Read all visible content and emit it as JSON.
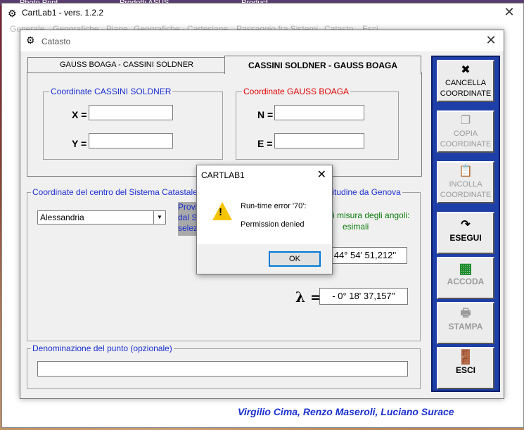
{
  "desktop": {
    "top_left_text": "Photo Print",
    "top_mid_text": "Prodotti ASUS",
    "top_right_text": "Product"
  },
  "main_window": {
    "title": "CartLab1 - vers. 1.2.2",
    "menu": [
      "Generale",
      "Geografiche - Piane",
      "Geografiche - Cartesiane",
      "Passaggio fra Sistemi",
      "Catasto",
      "Esci"
    ]
  },
  "catasto": {
    "title": "Catasto",
    "tabs": [
      "GAUSS BOAGA - CASSINI SOLDNER",
      "CASSINI SOLDNER - GAUSS BOAGA"
    ],
    "cassini_group": "Coordinate CASSINI SOLDNER",
    "gauss_group": "Coordinate GAUSS BOAGA",
    "x_label": "X =",
    "y_label": "Y =",
    "n_label": "N =",
    "e_label": "E =",
    "center_group": "Coordinate del centro del Sistema Catastale",
    "center_group_tail": "ngitudine da Genova",
    "province_select": "Alessandria",
    "prov_text": "Provi dal S selez",
    "angles_msg_1": "i misura degli angoli:",
    "angles_msg_2": "esimali",
    "phi_value": "44° 54' 51,212''",
    "lambda_symbol": "λ =",
    "lambda_value": "-  0° 18' 37,157''",
    "name_group": "Denominazione del punto (opzionale)"
  },
  "buttons": {
    "cancella": "CANCELLA COORDINATE",
    "copia": "COPIA COORDINATE",
    "incolla": "INCOLLA COORDINATE",
    "esegui": "ESEGUI",
    "accoda": "ACCODA",
    "stampa": "STAMPA",
    "esci": "ESCI"
  },
  "credits": "Virgilio Cima, Renzo Maseroli, Luciano Surace",
  "dialog": {
    "title": "CARTLAB1",
    "message_1": "Run-time error '70':",
    "message_2": "Permission denied",
    "ok_label": "OK"
  },
  "icons": {
    "app": "gear-icon",
    "cancella": "x-icon",
    "copia": "copy-icon",
    "incolla": "paste-icon",
    "esegui": "redo-icon",
    "accoda": "spreadsheet-icon",
    "stampa": "printer-icon",
    "esci": "exit-door-icon",
    "warning": "warning-icon"
  },
  "colors": {
    "panel": "#1f3fa8",
    "cassini_label": "#1a2fd0",
    "gauss_label": "#e00000",
    "angles_msg": "#0a7a0a",
    "warning": "#f5c400"
  }
}
